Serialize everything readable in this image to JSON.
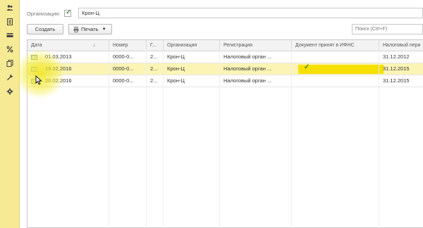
{
  "sidebar": {
    "items": [
      {
        "icon": "users-icon"
      },
      {
        "icon": "list-icon"
      },
      {
        "icon": "card-icon"
      },
      {
        "icon": "percent-icon"
      },
      {
        "icon": "documents-icon"
      },
      {
        "icon": "wrench-icon"
      },
      {
        "icon": "gear-icon"
      }
    ]
  },
  "filter": {
    "label": "Организация:",
    "checked": true,
    "value": "Крон-Ц"
  },
  "toolbar": {
    "create_label": "Создать",
    "print_label": "Печать",
    "search_placeholder": "Поиск (Ctrl+F)"
  },
  "table": {
    "columns": [
      "Дата",
      "Номер",
      "Г...",
      "Организация",
      "Регистрация",
      "Документ принят в ИФНС",
      "Налоговый пери"
    ],
    "sort_indicator": "↓",
    "rows": [
      {
        "date": "01.03.2013",
        "number": "0000-0...",
        "g": "2...",
        "org": "Крон-Ц",
        "registration": "Налоговый орган ...",
        "accepted": false,
        "period": "31.12.2012",
        "selected": false
      },
      {
        "date": "19.02.2016",
        "number": "0000-0...",
        "g": "2...",
        "org": "Крон-Ц",
        "registration": "Налоговый орган ...",
        "accepted": true,
        "period": "31.12.2015",
        "selected": true
      },
      {
        "date": "20.02.2016",
        "number": "0000-0...",
        "g": "2...",
        "org": "Крон-Ц",
        "registration": "Налоговый орган ...",
        "accepted": false,
        "period": "31.12.2015",
        "selected": false
      }
    ]
  },
  "colors": {
    "sidebar": "#f7ea94",
    "selected_row": "#fbf4b5",
    "accepted_cell": "#f7e000",
    "checkmark": "#3a8a1f"
  }
}
